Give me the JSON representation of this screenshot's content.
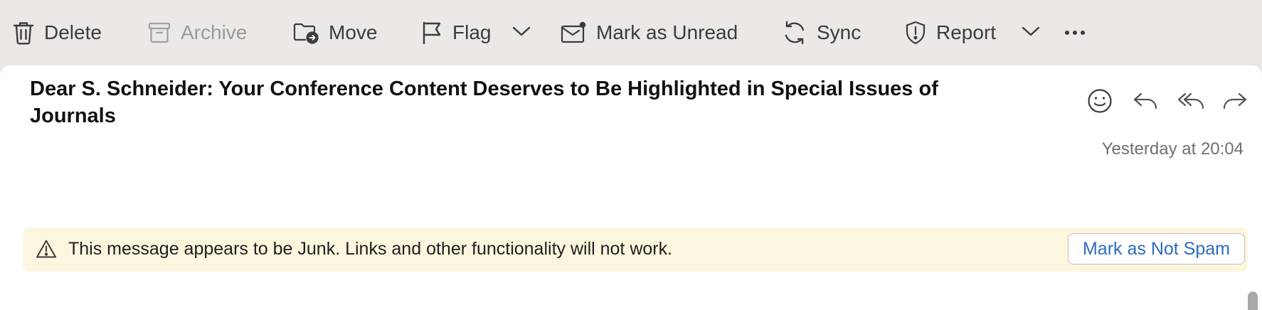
{
  "toolbar": {
    "delete_label": "Delete",
    "archive_label": "Archive",
    "move_label": "Move",
    "flag_label": "Flag",
    "mark_unread_label": "Mark as Unread",
    "sync_label": "Sync",
    "report_label": "Report",
    "more_icon": "more-icon"
  },
  "message": {
    "subject": "Dear S. Schneider: Your Conference Content Deserves to Be Highlighted in Special Issues of Journals",
    "timestamp": "Yesterday at 20:04"
  },
  "junk_banner": {
    "text": "This message appears to be Junk. Links and other functionality will not work.",
    "button_label": "Mark as Not Spam"
  },
  "colors": {
    "toolbar_bg": "#ebe8e5",
    "banner_bg": "#fbf6de",
    "link_blue": "#2c6cc0"
  }
}
